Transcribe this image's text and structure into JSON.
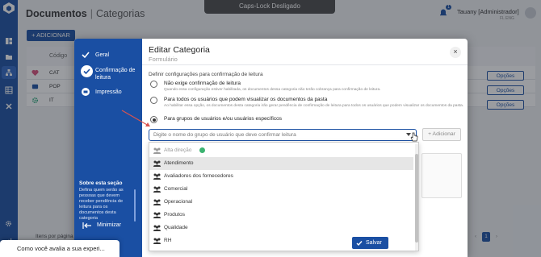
{
  "caps_lock_toast": "Caps-Lock Desligado",
  "page": {
    "title": "Documentos",
    "subtitle": "Categorias",
    "add_button": "+ ADICIONAR",
    "column_code": "Código",
    "rows": [
      {
        "code": "CAT",
        "icon": "heart-icon",
        "icon_color": "#d94f7a"
      },
      {
        "code": "POP",
        "icon": "card-icon",
        "icon_color": "#1a4fa3"
      },
      {
        "code": "IT",
        "icon": "gear-icon",
        "icon_color": "#2aa87a"
      }
    ],
    "options_label": "Opções",
    "items_per_page": "Itens por página",
    "current_page": "1"
  },
  "header": {
    "user_name": "Tauany [Administrador]",
    "user_sub": "FL ENG",
    "notification_count": "1"
  },
  "modal": {
    "title": "Editar Categoria",
    "subtitle": "Formulário",
    "steps": [
      {
        "label": "Geral",
        "icon": "check-icon"
      },
      {
        "label": "Confirmação de leitura",
        "icon": "check-icon"
      },
      {
        "label": "Impressão",
        "icon": "print-icon"
      }
    ],
    "about_title": "Sobre esta seção",
    "about_text": "Defina quem serão as pessoas que devem receber pendência de leitura para os documentos desta categoria",
    "minimize": "Minimizar",
    "config_title": "Definir configurações para confirmação de leitura",
    "options": [
      {
        "label": "Não exige confirmação de leitura",
        "desc": "Quando essa configuração estiver habilitada, os documentos dessa categoria não terão cobrança para confirmação de leitura.",
        "selected": false
      },
      {
        "label": "Para todos os usuários que podem visualizar os documentos da pasta",
        "desc": "Ao habilitar essa opção, os documentos desta categoria irão gerar pendência de confirmação de leitura para todos os usuários que podem visualizar os documentos da pasta.",
        "selected": false
      },
      {
        "label": "Para grupos de usuários e/ou usuários específicos",
        "desc": "",
        "selected": true
      }
    ],
    "group_placeholder": "Digite o nome do grupo de usuário que deve confirmar leitura",
    "add_label": "+ Adicionar",
    "dropdown": [
      {
        "label": "Alta direção",
        "disabled": true,
        "selected_badge": true
      },
      {
        "label": "Atendimento",
        "highlight": true
      },
      {
        "label": "Avaliadores dos fornecedores"
      },
      {
        "label": "Comercial"
      },
      {
        "label": "Operacional"
      },
      {
        "label": "Produtos"
      },
      {
        "label": "Qualidade"
      },
      {
        "label": "RH"
      }
    ],
    "save_label": "Salvar"
  },
  "survey": {
    "text": "Como você avalia a sua experi..."
  },
  "colors": {
    "primary": "#1a4fa3",
    "overlay": "rgba(30,35,45,0.45)"
  }
}
